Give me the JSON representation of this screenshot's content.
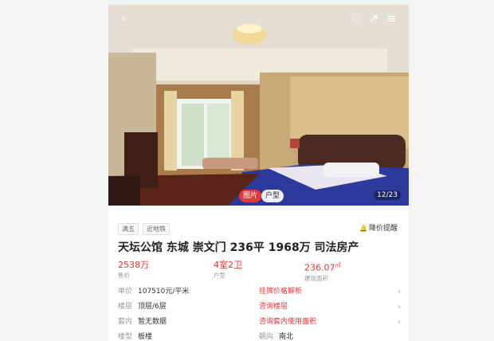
{
  "gallery": {
    "counter": "12/23",
    "tabs": [
      "图片",
      "户型"
    ]
  },
  "badges": [
    "满五",
    "近地铁"
  ],
  "price_alert": "降价提醒",
  "title": "天坛公馆 东城 崇文门 236平 1968万 司法房产",
  "stats": {
    "price": {
      "value": "2538万",
      "label": "售价"
    },
    "layout": {
      "value": "4室2卫",
      "label": "户型"
    },
    "area": {
      "value": "236.07",
      "unit": "㎡",
      "label": "建筑面积"
    }
  },
  "details": {
    "unit_price": {
      "key": "单价",
      "value": "107510元/平米",
      "link": "挂牌价格解析"
    },
    "floor": {
      "key": "楼层",
      "value": "顶层/6层",
      "link": "咨询楼层"
    },
    "inner": {
      "key": "套内",
      "value": "暂无数据",
      "link": "咨询套内使用面积"
    },
    "building": {
      "key": "楼型",
      "value": "板楼",
      "key2": "朝向",
      "value2": "南北"
    }
  },
  "colors": {
    "accent": "#e53935"
  }
}
